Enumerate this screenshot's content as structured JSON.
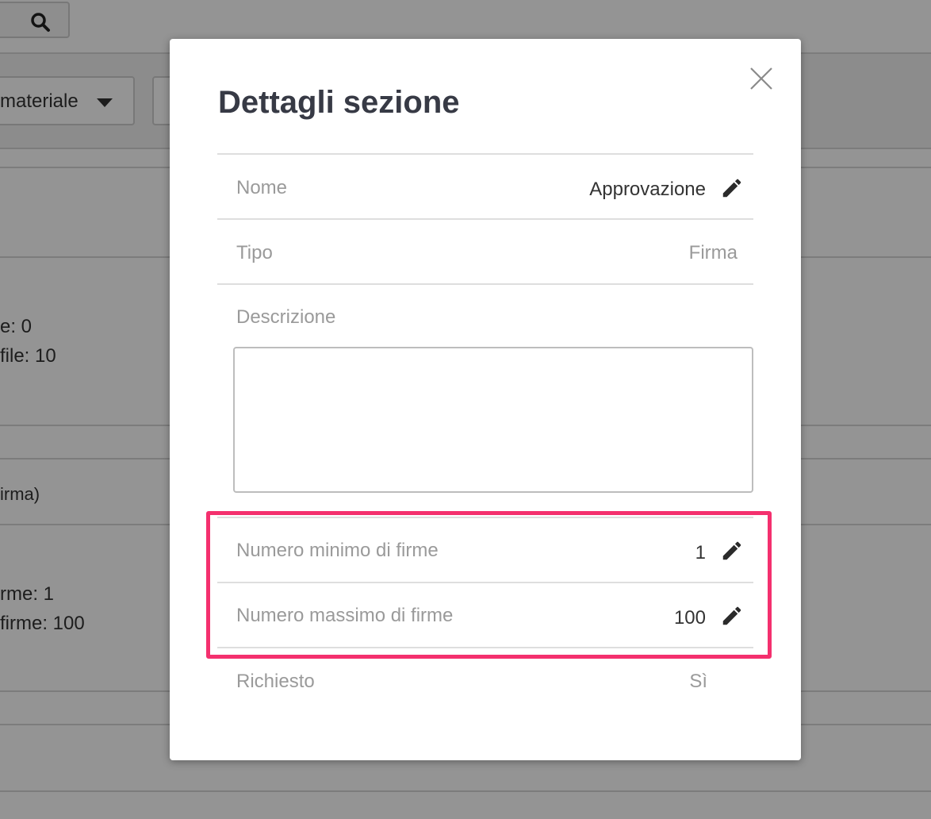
{
  "background": {
    "filter_label": "materiale",
    "lines": [
      "e: 0",
      "file: 10",
      "irma)",
      "rme: 1",
      "firme: 100"
    ]
  },
  "modal": {
    "title": "Dettagli sezione",
    "fields": {
      "name": {
        "label": "Nome",
        "value": "Approvazione"
      },
      "type": {
        "label": "Tipo",
        "value": "Firma"
      },
      "description": {
        "label": "Descrizione",
        "value": ""
      },
      "min_signatures": {
        "label": "Numero minimo di firme",
        "value": "1"
      },
      "max_signatures": {
        "label": "Numero massimo di firme",
        "value": "100"
      },
      "required": {
        "label": "Richiesto",
        "value": "Sì"
      }
    }
  },
  "colors": {
    "highlight": "#f4306e",
    "title": "#373a45",
    "label": "#9a9a9a"
  },
  "icons": {
    "close": "close-icon",
    "edit": "pencil-icon",
    "search": "search-icon",
    "dropdown": "caret-down-icon"
  }
}
